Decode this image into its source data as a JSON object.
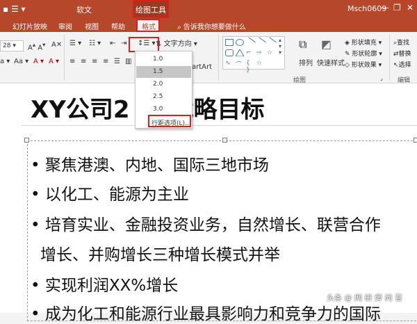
{
  "titlebar": {
    "doc_name": "软文",
    "tool_context": "绘图工具",
    "user": "Msch0609",
    "quick_access_icons": [
      "save-icon",
      "bullet-list-icon",
      "qat-dropdown-icon"
    ],
    "window_buttons": [
      "minimize-icon",
      "restore-icon",
      "close-icon"
    ]
  },
  "tabs": [
    {
      "label": "幻灯片放映"
    },
    {
      "label": "审阅"
    },
    {
      "label": "视图"
    },
    {
      "label": "帮助"
    },
    {
      "label": "格式",
      "active": true
    }
  ],
  "tell_me": "告诉我你想要做什么",
  "ribbon": {
    "font_size_value": "28",
    "text_direction_label": "文字方向",
    "smartart_label": "artArt",
    "drawing_group": "绘图",
    "editing_group": "编辑",
    "arrange_label": "排列",
    "quick_styles_label": "快速样式",
    "shape_fill": "形状填充",
    "shape_outline": "形状轮廓",
    "shape_effects": "形状效果",
    "find": "查找",
    "replace": "替换",
    "select": "选择"
  },
  "line_spacing_menu": {
    "options": [
      "1.0",
      "1.5",
      "2.0",
      "2.5",
      "3.0"
    ],
    "selected": "1.5",
    "more_label": "行距选项(L)..."
  },
  "slide": {
    "title_left": "XY公司2",
    "title_right": "战略目标",
    "bullets": [
      "聚焦港澳、内地、国际三地市场",
      "以化工、能源为主业",
      "培育实业、金融投资业务，自然增长、联营合作",
      "增长、并购增长三种增长模式并举",
      "实现利润XX%增长",
      "成为化工和能源行业最具影响力和竞争力的国际"
    ]
  },
  "watermark": "头条 @ 网 研 旁 问 苔",
  "colors": {
    "ppt_accent": "#b7472a",
    "highlight_box": "#e21b1b",
    "selected_option": "#c6c6c6"
  }
}
